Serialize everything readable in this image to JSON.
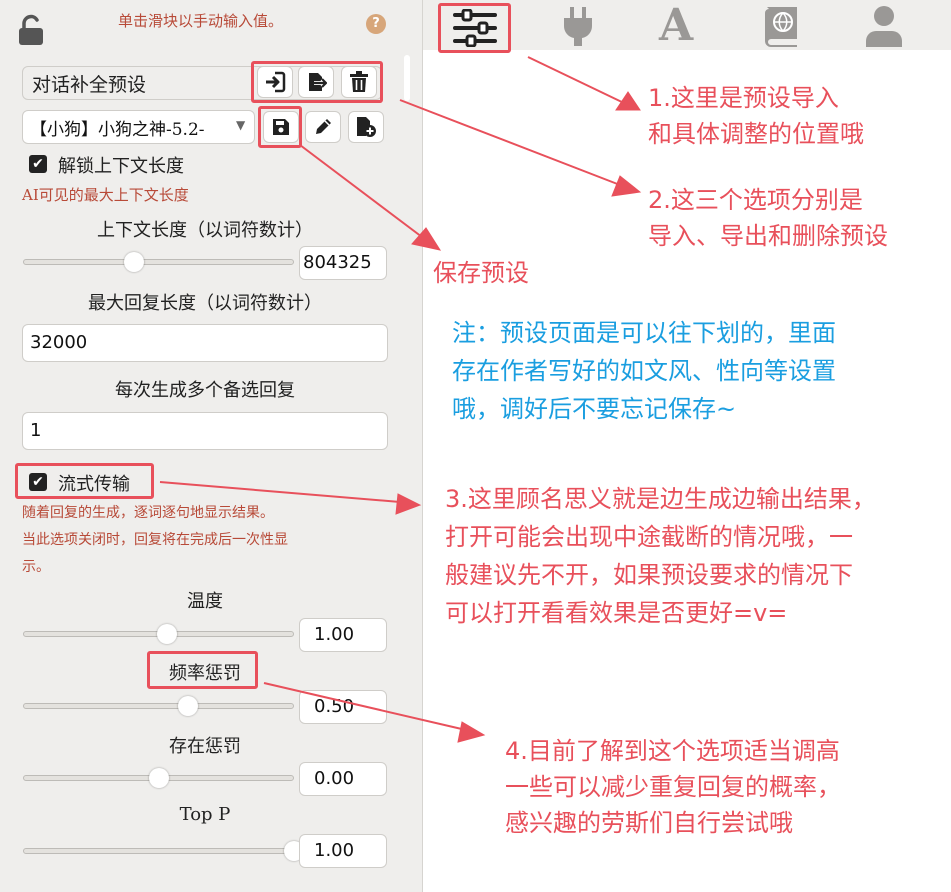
{
  "panel": {
    "top_hint": "单击滑块以手动输入值。",
    "preset_name": "对话补全预设",
    "preset_select": "【小狗】小狗之神-5.2-",
    "unlock_context_label": "解锁上下文长度",
    "unlock_context_hint": "AI可见的最大上下文长度",
    "context_length_label": "上下文长度（以词符数计）",
    "context_length_value": "804325",
    "max_reply_label": "最大回复长度（以词符数计）",
    "max_reply_value": "32000",
    "candidates_label": "每次生成多个备选回复",
    "candidates_value": "1",
    "streaming_label": "流式传输",
    "streaming_hint_1": "随着回复的生成，逐词逐句地显示结果。",
    "streaming_hint_2": "当此选项关闭时，回复将在完成后一次性显",
    "streaming_hint_3": "示。",
    "temperature_label": "温度",
    "temperature_value": "1.00",
    "temperature_level": 0.53,
    "freq_penalty_label": "频率惩罚",
    "freq_penalty_value": "0.50",
    "freq_penalty_level": 0.61,
    "presence_penalty_label": "存在惩罚",
    "presence_penalty_value": "0.00",
    "presence_penalty_level": 0.5,
    "top_p_label": "Top P",
    "top_p_value": "1.00",
    "top_p_level": 1.0,
    "context_level": 0.41,
    "help_icon": "?"
  },
  "annotations": {
    "a1_line1": "1.这里是预设导入",
    "a1_line2": "和具体调整的位置哦",
    "a2_line1": "2.这三个选项分别是",
    "a2_line2": "导入、导出和删除预设",
    "a_save": "保存预设",
    "note_line1": "注：预设页面是可以往下划的，里面",
    "note_line2": "存在作者写好的如文风、性向等设置",
    "note_line3": "哦，调好后不要忘记保存~",
    "a3_line1": "3.这里顾名思义就是边生成边输出结果，",
    "a3_line2": "打开可能会出现中途截断的情况哦，一",
    "a3_line3": "般建议先不开，如果预设要求的情况下",
    "a3_line4": "可以打开看看效果是否更好=v=",
    "a4_line1": "4.目前了解到这个选项适当调高",
    "a4_line2": "一些可以减少重复回复的概率，",
    "a4_line3": "感兴趣的劳斯们自行尝试哦"
  },
  "colors": {
    "annotation_red": "#e8505b",
    "annotation_blue": "#1a9ee0",
    "hint_red": "#b84a38",
    "panel_bg": "#efeeec"
  },
  "icons": [
    "lock-icon",
    "help-icon",
    "import-icon",
    "export-icon",
    "trash-icon",
    "save-icon",
    "pencil-icon",
    "new-file-icon",
    "sliders-icon",
    "plug-icon",
    "font-icon",
    "book-globe-icon",
    "user-icon"
  ]
}
